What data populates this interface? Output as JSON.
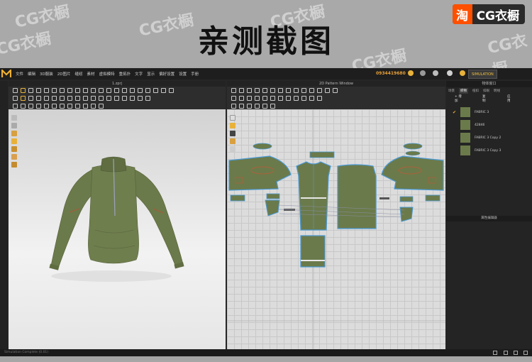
{
  "banner": {
    "title": "亲测截图",
    "watermark": "CG衣橱"
  },
  "brand": {
    "taobao_glyph": "淘",
    "name": "CG衣橱"
  },
  "menubar": {
    "items": [
      "文件",
      "编辑",
      "3D服装",
      "2D图片",
      "缝纫",
      "素材",
      "虚拟模特",
      "重拓扑",
      "文字",
      "显示",
      "偏好设置",
      "设置",
      "手册"
    ],
    "phone": "0934419680",
    "simulation_label": "SIMULATION"
  },
  "viewport3d": {
    "title": "1.zprj"
  },
  "viewport2d": {
    "title": "2D Pattern Window"
  },
  "object_browser": {
    "title": "物体窗口",
    "tabs": [
      "场景",
      "织物",
      "纽扣",
      "扣眼",
      "明线"
    ],
    "active_tab": "织物",
    "add_label": "+ 增加",
    "copy_label": "复制",
    "apply_label": "应用",
    "fabrics": [
      {
        "name": "FABRIC 3",
        "checked": true
      },
      {
        "name": "42846",
        "checked": false
      },
      {
        "name": "FABRIC 3 Copy 2",
        "checked": false
      },
      {
        "name": "FABRIC 3 Copy 3",
        "checked": false
      }
    ],
    "properties_title": "属性编辑器"
  },
  "status": {
    "text": "Simulation Complete (0.01)"
  },
  "colors": {
    "fabric": "#6b7a4a",
    "accent": "#e8b23a",
    "brand_orange": "#ff5000",
    "phone": "#e8a23a"
  }
}
